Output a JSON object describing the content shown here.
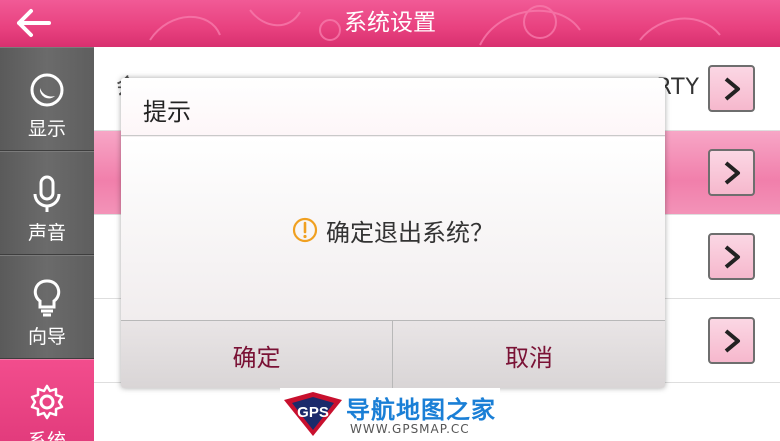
{
  "header": {
    "title": "系统设置"
  },
  "sidebar": {
    "items": [
      {
        "label": "显示",
        "icon": "moon-icon"
      },
      {
        "label": "声音",
        "icon": "microphone-icon"
      },
      {
        "label": "向导",
        "icon": "lightbulb-icon"
      },
      {
        "label": "系统",
        "icon": "gear-icon",
        "active": true
      }
    ]
  },
  "rows": [
    {
      "left_text": "会",
      "value": "RTY"
    },
    {
      "left_text": ""
    },
    {
      "left_text": ""
    },
    {
      "left_text": ""
    }
  ],
  "dialog": {
    "title": "提示",
    "message": "确定退出系统？",
    "confirm_label": "确定",
    "cancel_label": "取消"
  },
  "watermark": {
    "logo_text": "GPS",
    "name": "导航地图之家",
    "url": "WWW.GPSMAP.CC"
  },
  "colors": {
    "accent": "#e8417f",
    "sidebar": "#606060",
    "dialog_button_text": "#7a1235",
    "warning": "#f0a020"
  }
}
